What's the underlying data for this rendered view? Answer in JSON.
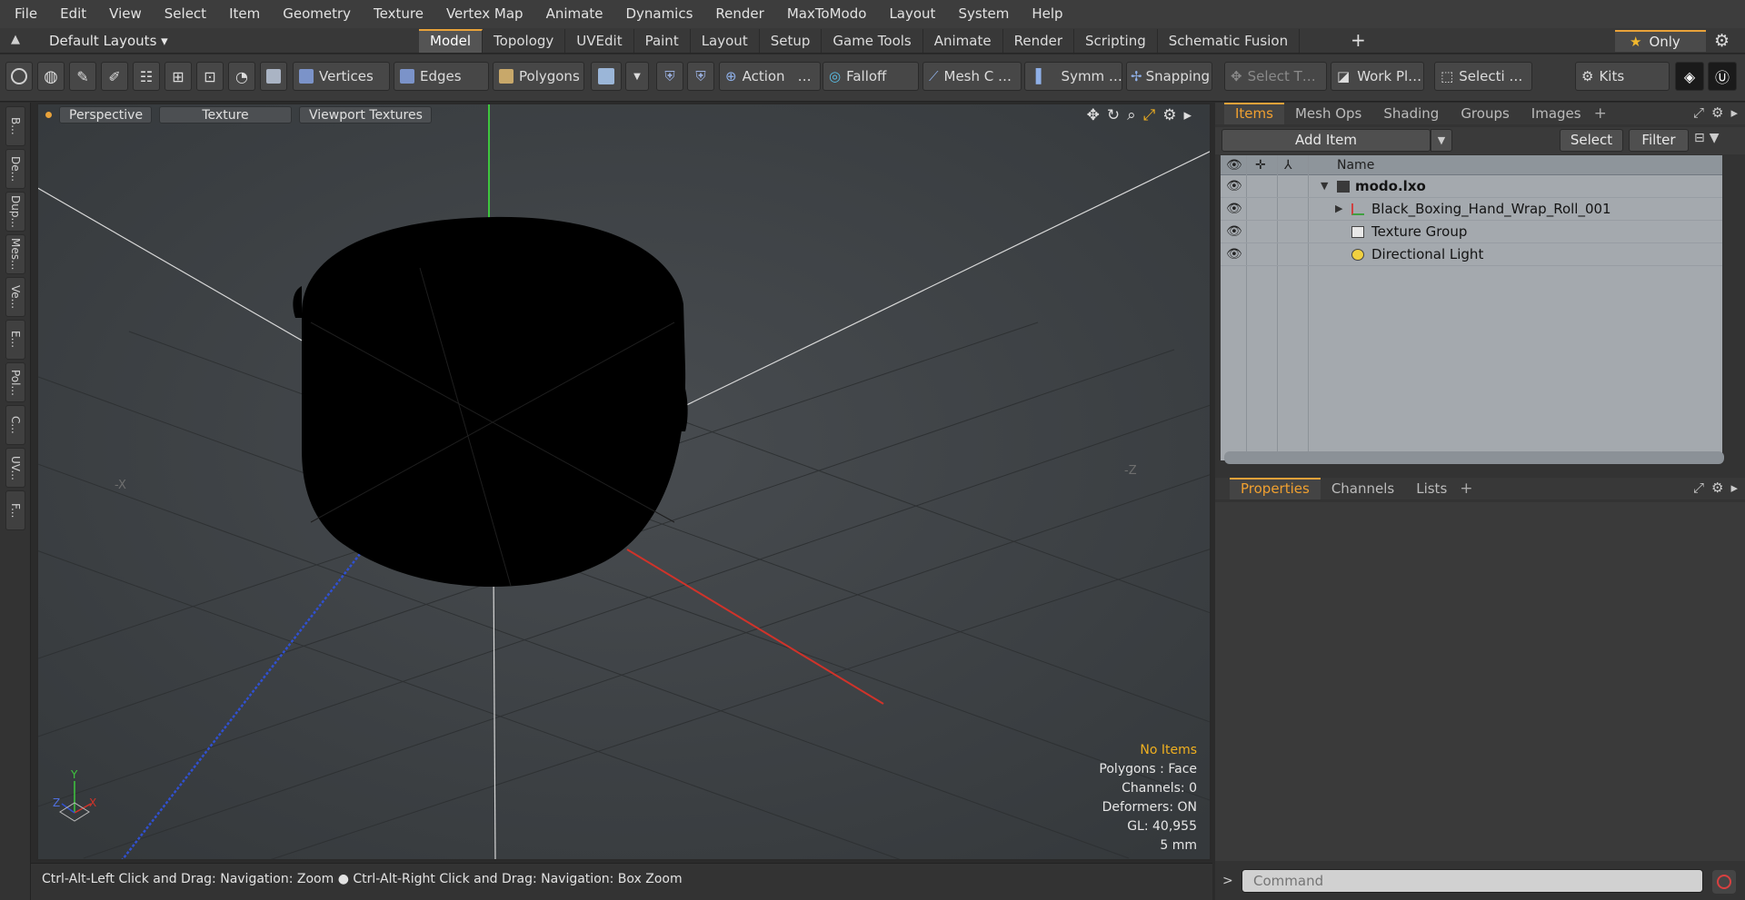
{
  "menu": [
    "File",
    "Edit",
    "View",
    "Select",
    "Item",
    "Geometry",
    "Texture",
    "Vertex Map",
    "Animate",
    "Dynamics",
    "Render",
    "MaxToModo",
    "Layout",
    "System",
    "Help"
  ],
  "layout_bar": {
    "layout_select": "Default Layouts ▾",
    "tabs": [
      "Model",
      "Topology",
      "UVEdit",
      "Paint",
      "Layout",
      "Setup",
      "Game Tools",
      "Animate",
      "Render",
      "Scripting",
      "Schematic Fusion"
    ],
    "active_tab": "Model",
    "only_label": "Only"
  },
  "toolbar": {
    "vertices": "Vertices",
    "edges": "Edges",
    "polygons": "Polygons",
    "action": "Action",
    "action_more": "…",
    "falloff": "Falloff",
    "mesh": "Mesh C …",
    "symmetry": "Symm …",
    "snapping": "Snapping",
    "select_t": "Select T…",
    "work_plane": "Work Pl…",
    "selection": "Selecti …",
    "kits": "Kits"
  },
  "left_strip": [
    "B...",
    "De...",
    "Dup...",
    "Mes...",
    "Ve...",
    "E...",
    "Pol...",
    "C...",
    "UV...",
    "F..."
  ],
  "viewport": {
    "view_mode": "Perspective",
    "shading": "Texture",
    "viewport_textures": "Viewport Textures",
    "axis_x_label": "-X",
    "axis_z_label": "-Z",
    "gizmo_y": "Y",
    "gizmo_z": "Z",
    "gizmo_x": "X",
    "info": {
      "selection": "No Items",
      "polygons": "Polygons : Face",
      "channels": "Channels: 0",
      "deformers": "Deformers: ON",
      "gl": "GL: 40,955",
      "unit": "5 mm"
    }
  },
  "status_bar": "Ctrl-Alt-Left Click and Drag: Navigation: Zoom ● Ctrl-Alt-Right Click and Drag: Navigation: Box Zoom",
  "items_panel": {
    "tabs": [
      "Items",
      "Mesh Ops",
      "Shading",
      "Groups",
      "Images"
    ],
    "active_tab": "Items",
    "add_item": "Add Item",
    "select": "Select",
    "filter": "Filter",
    "name_header": "Name",
    "rows": [
      {
        "label": "modo.lxo",
        "bold": true,
        "icon": "scene-icon"
      },
      {
        "label": "Black_Boxing_Hand_Wrap_Roll_001",
        "bold": false,
        "icon": "mesh-icon"
      },
      {
        "label": "Texture Group",
        "bold": false,
        "icon": "texture-group-icon"
      },
      {
        "label": "Directional Light",
        "bold": false,
        "icon": "light-icon"
      }
    ]
  },
  "properties_panel": {
    "tabs": [
      "Properties",
      "Channels",
      "Lists"
    ],
    "active_tab": "Properties"
  },
  "command": {
    "placeholder": "Command"
  },
  "colors": {
    "accent": "#e8a23a",
    "axis_x": "#d0332a",
    "axis_y": "#3ec63e",
    "axis_z": "#3050d0"
  }
}
